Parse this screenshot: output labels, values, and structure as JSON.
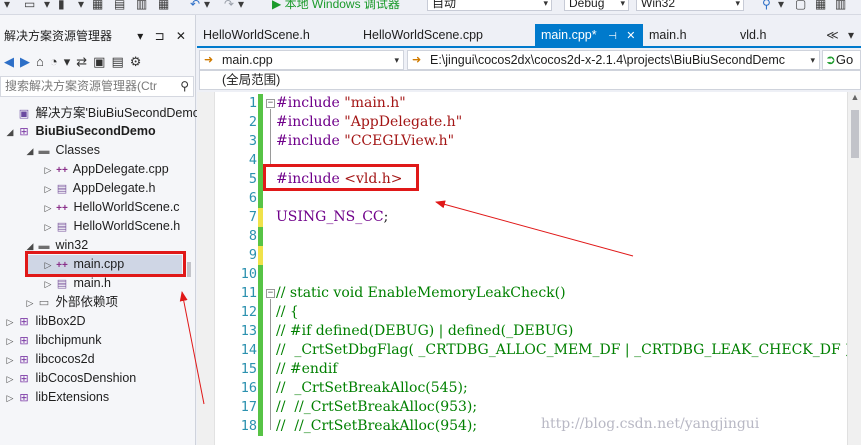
{
  "toolbar": {
    "run_label": "▶ 本地 Windows 调试器",
    "combo_auto": "自动",
    "combo_config": "Debug",
    "combo_platform": "Win32"
  },
  "explorer": {
    "title": "解决方案资源管理器",
    "title_icons": "▾ ⊐ ✕",
    "search_placeholder": "搜索解决方案资源管理器(Ctr",
    "search_icon": "⚲",
    "tree": [
      {
        "label": "解决方案'BiuBiuSecondDemo",
        "icon": "solution-icon"
      },
      {
        "label": "BiuBiuSecondDemo",
        "icon": "project-icon"
      },
      {
        "label": "Classes",
        "icon": "folder-icon"
      },
      {
        "label": "AppDelegate.cpp",
        "icon": "cpp-file-icon"
      },
      {
        "label": "AppDelegate.h",
        "icon": "header-file-icon"
      },
      {
        "label": "HelloWorldScene.c",
        "icon": "cpp-file-icon"
      },
      {
        "label": "HelloWorldScene.h",
        "icon": "header-file-icon"
      },
      {
        "label": "win32",
        "icon": "folder-icon"
      },
      {
        "label": "main.cpp",
        "icon": "cpp-file-icon"
      },
      {
        "label": "main.h",
        "icon": "header-file-icon"
      },
      {
        "label": "外部依赖项",
        "icon": "external-deps-icon"
      },
      {
        "label": "libBox2D",
        "icon": "project-icon"
      },
      {
        "label": "libchipmunk",
        "icon": "project-icon"
      },
      {
        "label": "libcocos2d",
        "icon": "project-icon"
      },
      {
        "label": "libCocosDenshion",
        "icon": "project-icon"
      },
      {
        "label": "libExtensions",
        "icon": "project-icon"
      }
    ]
  },
  "tabs": [
    {
      "label": "HelloWorldScene.h"
    },
    {
      "label": "HelloWorldScene.cpp"
    },
    {
      "label": "main.cpp*"
    },
    {
      "label": "main.h"
    },
    {
      "label": "vld.h"
    }
  ],
  "tab_overflow": "≪ ▾",
  "nav": {
    "file_combo": "main.cpp",
    "scope_combo": "(全局范围)",
    "path_combo": "E:\\jingui\\cocos2dx\\cocos2d-x-2.1.4\\projects\\BiuBiuSecondDemc",
    "go_label": "Go"
  },
  "code_lines": [
    {
      "no": "1",
      "text": "#include \"main.h\""
    },
    {
      "no": "2",
      "text": "#include \"AppDelegate.h\""
    },
    {
      "no": "3",
      "text": "#include \"CCEGLView.h\""
    },
    {
      "no": "4",
      "text": ""
    },
    {
      "no": "5",
      "text": "#include <vld.h>"
    },
    {
      "no": "6",
      "text": ""
    },
    {
      "no": "7",
      "text": "USING_NS_CC;"
    },
    {
      "no": "8",
      "text": ""
    },
    {
      "no": "9",
      "text": ""
    },
    {
      "no": "10",
      "text": ""
    },
    {
      "no": "11",
      "text": "// static void EnableMemoryLeakCheck()"
    },
    {
      "no": "12",
      "text": "// {"
    },
    {
      "no": "13",
      "text": "// #if defined(DEBUG) | defined(_DEBUG)"
    },
    {
      "no": "14",
      "text": "//  _CrtSetDbgFlag( _CRTDBG_ALLOC_MEM_DF | _CRTDBG_LEAK_CHECK_DF );"
    },
    {
      "no": "15",
      "text": "// #endif"
    },
    {
      "no": "16",
      "text": "//  _CrtSetBreakAlloc(545);"
    },
    {
      "no": "17",
      "text": "//  //_CrtSetBreakAlloc(953);"
    },
    {
      "no": "18",
      "text": "//  //_CrtSetBreakAlloc(954);"
    }
  ],
  "watermark": "http://blog.csdn.net/yangjingui",
  "colors": {
    "accent": "#007acc",
    "highlight_red": "#e01818",
    "change_saved": "#57c346",
    "change_unsaved": "#f0e24a"
  }
}
